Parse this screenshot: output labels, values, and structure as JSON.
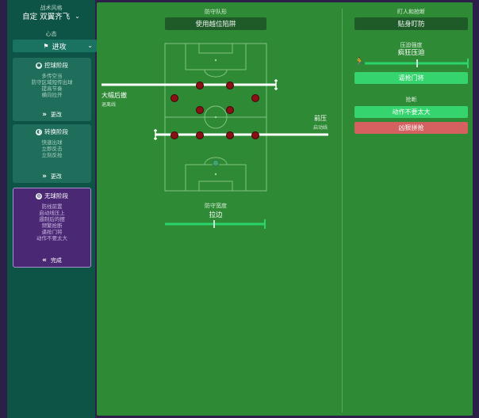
{
  "sidebar": {
    "tactic_style_caption": "战术风格",
    "tactic_style_value": "自定 双翼齐飞",
    "mentality_caption": "心态",
    "mentality_value": "进攻",
    "phases": [
      {
        "title": "控球阶段",
        "lines": [
          "多传空当",
          "防守区域短传出球",
          "提高节奏",
          "横向拉开"
        ],
        "action": "更改"
      },
      {
        "title": "转换阶段",
        "lines": [
          "快速出球",
          "立即反击",
          "立刻反抢"
        ],
        "action": "更改"
      },
      {
        "title": "无球阶段",
        "lines": [
          "防线前置",
          "启动线压上",
          "遏制后的摆",
          "频繁抢断",
          "逼抢门将",
          "动作不要太大"
        ],
        "action": "完成"
      }
    ]
  },
  "defense": {
    "shape_caption": "防守队形",
    "shape_value": "使用越位陷阱",
    "back_line_label": "大幅后撤",
    "back_line_sub": "退离线",
    "front_line_label": "前压",
    "front_line_sub": "启动线",
    "width_caption": "防守宽度",
    "width_value": "拉边",
    "width_level": 0.5
  },
  "marking": {
    "caption": "盯人和抢断",
    "value": "贴身盯防",
    "press_caption": "压迫强度",
    "press_value": "疯狂压迫",
    "press_level": 0.55,
    "press_goalkeeper": "逼抢门将",
    "tackling_caption": "抢断",
    "tackle_normal": "动作不要太大",
    "tackle_hard": "凶狠拼抢"
  },
  "colors": {
    "pitch": "#2f8a36",
    "player_fill": "#8c0f16",
    "accent_green": "#35d46e",
    "danger": "#d46060"
  }
}
